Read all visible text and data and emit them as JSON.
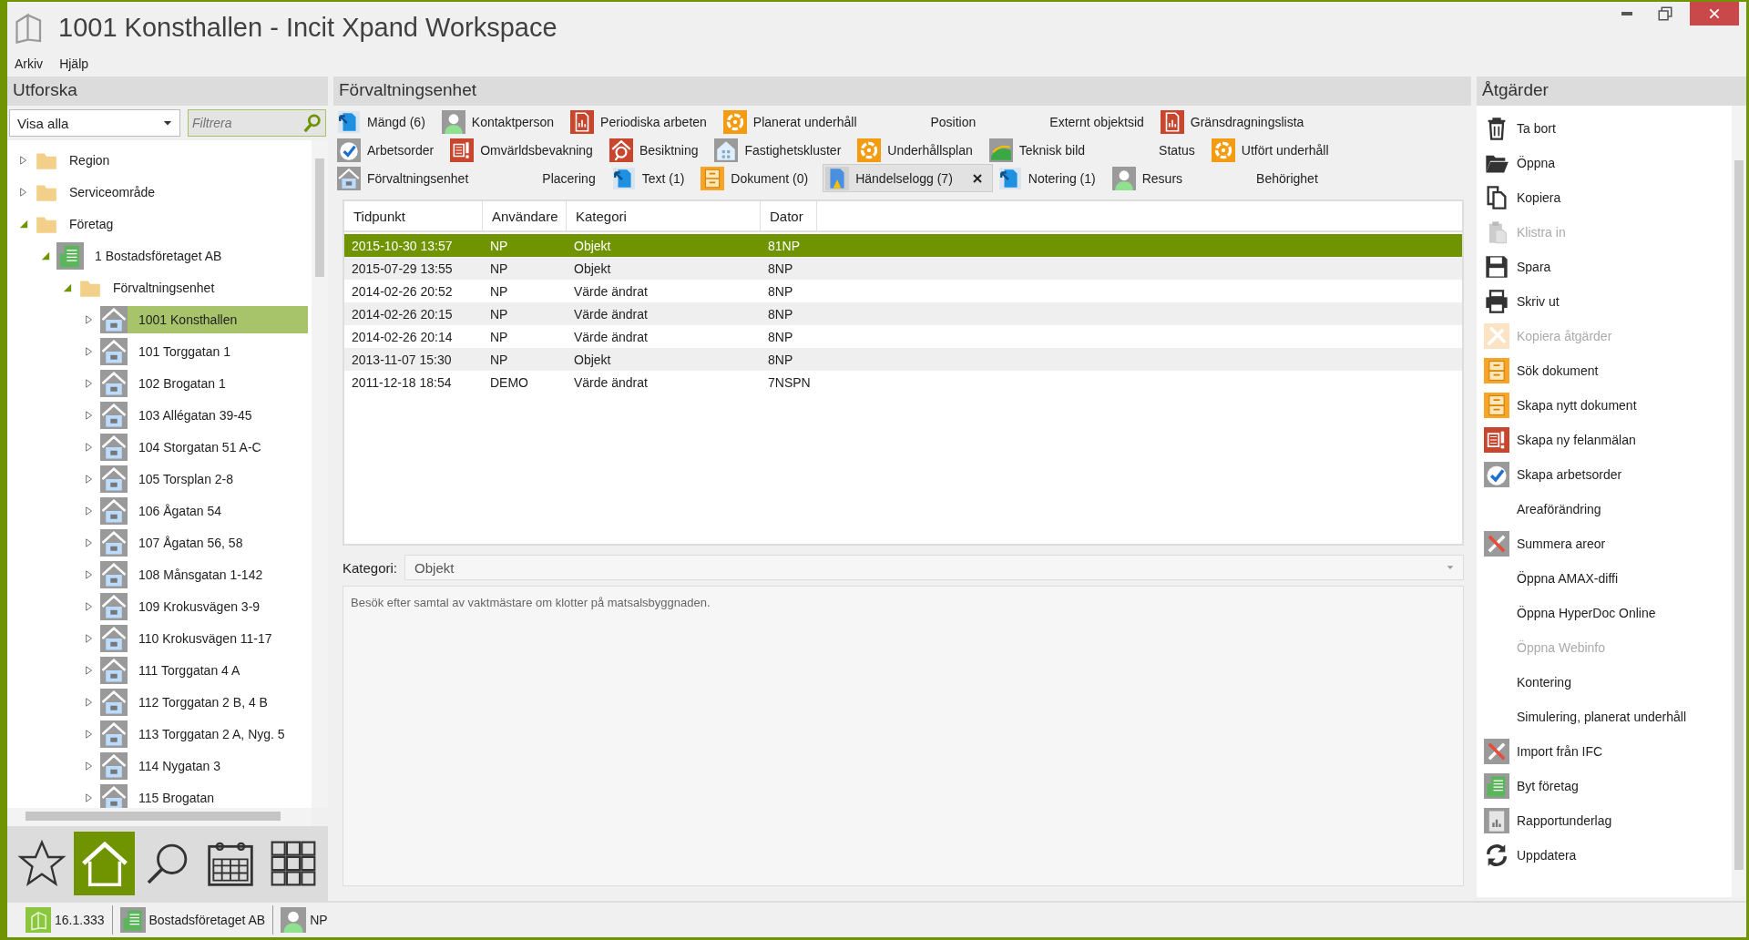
{
  "window": {
    "title": "1001 Konsthallen - Incit Xpand Workspace"
  },
  "menu": [
    "Arkiv",
    "Hjälp"
  ],
  "explorer": {
    "title": "Utforska",
    "filter_select": "Visa alla",
    "search": {
      "placeholder": "Filtrera"
    },
    "tree": [
      {
        "label": "Region",
        "kind": "folder",
        "expanded": false,
        "selected": false
      },
      {
        "label": "Serviceområde",
        "kind": "folder",
        "expanded": false,
        "selected": false
      },
      {
        "label": "Företag",
        "kind": "folder",
        "expanded": true,
        "selected": false,
        "children": [
          {
            "label": "1 Bostadsföretaget AB",
            "kind": "company",
            "expanded": true,
            "selected": false,
            "children": [
              {
                "label": "Förvaltningsenhet",
                "kind": "folder",
                "expanded": true,
                "selected": false,
                "children": [
                  {
                    "label": "1001 Konsthallen",
                    "kind": "unit",
                    "expanded": false,
                    "selected": true
                  },
                  {
                    "label": "101 Torggatan 1",
                    "kind": "unit",
                    "expanded": false,
                    "selected": false
                  },
                  {
                    "label": "102 Brogatan 1",
                    "kind": "unit",
                    "expanded": false,
                    "selected": false
                  },
                  {
                    "label": "103 Allégatan 39-45",
                    "kind": "unit",
                    "expanded": false,
                    "selected": false
                  },
                  {
                    "label": "104 Storgatan 51 A-C",
                    "kind": "unit",
                    "expanded": false,
                    "selected": false
                  },
                  {
                    "label": "105 Torsplan 2-8",
                    "kind": "unit",
                    "expanded": false,
                    "selected": false
                  },
                  {
                    "label": "106 Ågatan 54",
                    "kind": "unit",
                    "expanded": false,
                    "selected": false
                  },
                  {
                    "label": "107 Ågatan 56, 58",
                    "kind": "unit",
                    "expanded": false,
                    "selected": false
                  },
                  {
                    "label": "108 Månsgatan 1-142",
                    "kind": "unit",
                    "expanded": false,
                    "selected": false
                  },
                  {
                    "label": "109 Krokusvägen  3-9",
                    "kind": "unit",
                    "expanded": false,
                    "selected": false
                  },
                  {
                    "label": "110 Krokusvägen 11-17",
                    "kind": "unit",
                    "expanded": false,
                    "selected": false
                  },
                  {
                    "label": "111 Torggatan 4 A",
                    "kind": "unit",
                    "expanded": false,
                    "selected": false
                  },
                  {
                    "label": "112 Torggatan 2 B, 4 B",
                    "kind": "unit",
                    "expanded": false,
                    "selected": false
                  },
                  {
                    "label": "113 Torggatan 2 A, Nyg. 5",
                    "kind": "unit",
                    "expanded": false,
                    "selected": false
                  },
                  {
                    "label": "114 Nygatan 3",
                    "kind": "unit",
                    "expanded": false,
                    "selected": false
                  },
                  {
                    "label": "115 Brogatan",
                    "kind": "unit",
                    "expanded": false,
                    "selected": false
                  }
                ]
              }
            ]
          }
        ]
      }
    ]
  },
  "nav": [
    {
      "kind": "favorites",
      "selected": false
    },
    {
      "kind": "home",
      "selected": true
    },
    {
      "kind": "search",
      "selected": false
    },
    {
      "kind": "calendar",
      "selected": false
    },
    {
      "kind": "apps",
      "selected": false
    }
  ],
  "content": {
    "title": "Förvaltningsenhet",
    "tab_rows": [
      [
        {
          "label": "Mängd (6)",
          "kind": "link",
          "selected": false
        },
        {
          "label": "Kontaktperson",
          "kind": "person",
          "selected": false
        },
        {
          "label": "Periodiska arbeten",
          "kind": "report",
          "selected": false
        },
        {
          "label": "Planerat underhåll",
          "kind": "gear",
          "selected": false
        },
        {
          "label": "Position",
          "kind": "plain",
          "selected": false
        },
        {
          "label": "Externt objektsid",
          "kind": "plain",
          "selected": false
        },
        {
          "label": "Gränsdragningslista",
          "kind": "report",
          "selected": false
        }
      ],
      [
        {
          "label": "Arbetsorder",
          "kind": "check",
          "selected": false
        },
        {
          "label": "Omvärldsbevakning",
          "kind": "alert",
          "selected": false
        },
        {
          "label": "Besiktning",
          "kind": "inspect",
          "selected": false
        },
        {
          "label": "Fastighetskluster",
          "kind": "building",
          "selected": false
        },
        {
          "label": "Underhållsplan",
          "kind": "gear",
          "selected": false
        },
        {
          "label": "Teknisk bild",
          "kind": "image",
          "selected": false
        },
        {
          "label": "Status",
          "kind": "plain",
          "selected": false
        },
        {
          "label": "Utfört underhåll",
          "kind": "gear",
          "selected": false
        }
      ],
      [
        {
          "label": "Förvaltningsenhet",
          "kind": "house",
          "selected": false
        },
        {
          "label": "Placering",
          "kind": "plain",
          "selected": false
        },
        {
          "label": "Text (1)",
          "kind": "link",
          "selected": false
        },
        {
          "label": "Dokument (0)",
          "kind": "document",
          "selected": false
        },
        {
          "label": "Händelselogg (7)",
          "kind": "log",
          "selected": true
        },
        {
          "label": "Notering (1)",
          "kind": "link",
          "selected": false
        },
        {
          "label": "Resurs",
          "kind": "person",
          "selected": false
        },
        {
          "label": "Behörighet",
          "kind": "plain",
          "selected": false
        }
      ]
    ],
    "table": {
      "columns": [
        "Tidpunkt",
        "Användare",
        "Kategori",
        "Dator"
      ],
      "rows": [
        {
          "cells": [
            "2015-10-30 13:57",
            "NP",
            "Objekt",
            "81NP"
          ],
          "selected": true
        },
        {
          "cells": [
            "2015-07-29 13:55",
            "NP",
            "Objekt",
            "8NP"
          ],
          "selected": false
        },
        {
          "cells": [
            "2014-02-26 20:52",
            "NP",
            "Värde ändrat",
            "8NP"
          ],
          "selected": false
        },
        {
          "cells": [
            "2014-02-26 20:15",
            "NP",
            "Värde ändrat",
            "8NP"
          ],
          "selected": false
        },
        {
          "cells": [
            "2014-02-26 20:14",
            "NP",
            "Värde ändrat",
            "8NP"
          ],
          "selected": false
        },
        {
          "cells": [
            "2013-11-07 15:30",
            "NP",
            "Objekt",
            "8NP"
          ],
          "selected": false
        },
        {
          "cells": [
            "2011-12-18 18:54",
            "DEMO",
            "Värde ändrat",
            "7NSPN"
          ],
          "selected": false
        }
      ]
    },
    "category": {
      "label": "Kategori:",
      "value": "Objekt"
    },
    "description": "Besök efter samtal av vaktmästare om klotter på matsalsbyggnaden."
  },
  "actions": {
    "title": "Åtgärder",
    "items": [
      {
        "label": "Ta bort",
        "kind": "trash",
        "disabled": false
      },
      {
        "label": "Öppna",
        "kind": "folder",
        "disabled": false
      },
      {
        "label": "Kopiera",
        "kind": "copy",
        "disabled": false
      },
      {
        "label": "Klistra in",
        "kind": "paste",
        "disabled": true
      },
      {
        "label": "Spara",
        "kind": "save",
        "disabled": false
      },
      {
        "label": "Skriv ut",
        "kind": "print",
        "disabled": false
      },
      {
        "label": "Kopiera åtgärder",
        "kind": "tools-orange",
        "disabled": true
      },
      {
        "label": "Sök dokument",
        "kind": "document",
        "disabled": false
      },
      {
        "label": "Skapa nytt dokument",
        "kind": "document",
        "disabled": false
      },
      {
        "label": "Skapa ny felanmälan",
        "kind": "alert",
        "disabled": false
      },
      {
        "label": "Skapa arbetsorder",
        "kind": "check",
        "disabled": false
      },
      {
        "label": "Areaförändring",
        "kind": "plain",
        "disabled": false
      },
      {
        "label": "Summera areor",
        "kind": "tools",
        "disabled": false
      },
      {
        "label": "Öppna AMAX-diffi",
        "kind": "plain",
        "disabled": false
      },
      {
        "label": "Öppna HyperDoc Online",
        "kind": "plain",
        "disabled": false
      },
      {
        "label": "Öppna Webinfo",
        "kind": "plain",
        "disabled": true
      },
      {
        "label": "Kontering",
        "kind": "plain",
        "disabled": false
      },
      {
        "label": "Simulering, planerat underhåll",
        "kind": "plain",
        "disabled": false
      },
      {
        "label": "Import från IFC",
        "kind": "tools",
        "disabled": false
      },
      {
        "label": "Byt företag",
        "kind": "company",
        "disabled": false
      },
      {
        "label": "Rapportunderlag",
        "kind": "chart",
        "disabled": false
      },
      {
        "label": "Uppdatera",
        "kind": "refresh",
        "disabled": false
      }
    ]
  },
  "status_bar": {
    "version": "16.1.333",
    "company": "Bostadsföretaget AB",
    "user": "NP"
  }
}
